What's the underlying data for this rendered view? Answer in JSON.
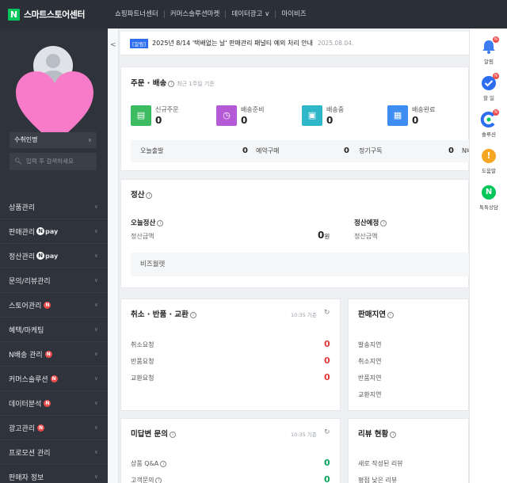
{
  "header": {
    "brand_letter": "N",
    "brand_title": "스마트스토어센터",
    "nav": [
      "쇼핑파트너센터",
      "커머스솔루션마켓",
      "데이터광고 ∨",
      "마이비즈"
    ]
  },
  "sidebar": {
    "store_name": "수취인명",
    "search_placeholder": "입력 후 검색하세요",
    "menu": [
      {
        "label": "상품관리"
      },
      {
        "label": "판매관리",
        "pay": "pay"
      },
      {
        "label": "정산관리",
        "pay": "pay"
      },
      {
        "label": "문의/리뷰관리"
      },
      {
        "label": "스토어관리",
        "badge": "N"
      },
      {
        "label": "혜택/마케팅"
      },
      {
        "label": "N배송 관리",
        "badge": "N"
      },
      {
        "label": "커머스솔루션",
        "badge": "N"
      },
      {
        "label": "데이터분석",
        "badge": "N"
      },
      {
        "label": "광고관리",
        "badge": "N"
      },
      {
        "label": "프로모션 관리"
      },
      {
        "label": "판매자 정보"
      }
    ],
    "npay_letter": "N",
    "colors": {
      "bg": "#2f333b",
      "badge": "#ef4b4b"
    }
  },
  "notice": {
    "tag": "[알림]",
    "text": "2025년 8/14 '택배없는 날' 판매관리 패널티 예외 처리 안내",
    "date": "2025.08.04."
  },
  "order": {
    "title": "주문 · 배송",
    "note": "최근 1주일 기준",
    "stats": [
      {
        "label": "신규주문",
        "value": "0",
        "icon": "new-order-icon",
        "color": "#3dbb61"
      },
      {
        "label": "배송준비",
        "value": "0",
        "icon": "clock-icon",
        "color": "#b55ad6"
      },
      {
        "label": "배송중",
        "value": "0",
        "icon": "truck-icon",
        "color": "#2fb6c9"
      },
      {
        "label": "배송완료",
        "value": "0",
        "icon": "gift-icon",
        "color": "#3d8ef0"
      }
    ],
    "row": [
      {
        "label": "오늘출발",
        "value": "0"
      },
      {
        "label": "예약구매",
        "value": "0"
      },
      {
        "label": "정기구독",
        "value": "0"
      },
      {
        "label": "N배송",
        "value": ""
      }
    ]
  },
  "settlement": {
    "title": "정산",
    "today_label": "오늘정산",
    "today_sub": "정산금액",
    "today_value": "0",
    "unit": "원",
    "expected_label": "정산예정",
    "expected_sub": "정산금액",
    "bizwallet": "비즈월렛"
  },
  "claims": {
    "title": "취소 · 반품 · 교환",
    "time": "10:35 기준",
    "rows": [
      {
        "label": "취소요청",
        "value": "0"
      },
      {
        "label": "반품요청",
        "value": "0"
      },
      {
        "label": "교환요청",
        "value": "0"
      }
    ]
  },
  "delay": {
    "title": "판매지연",
    "rows": [
      "발송지연",
      "취소지연",
      "반품지연",
      "교환지연"
    ]
  },
  "inquiry": {
    "title": "미답변 문의",
    "time": "10:35 기준",
    "rows": [
      {
        "label": "상품 Q&A",
        "value": "0"
      },
      {
        "label": "고객문의",
        "value": "0"
      }
    ]
  },
  "review": {
    "title": "리뷰 현황",
    "rows": [
      "새로 작성된 리뷰",
      "평점 낮은 리뷰"
    ]
  },
  "rail": [
    {
      "label": "알림",
      "icon": "bell-icon",
      "color": "#3d7bf0",
      "dot": "N"
    },
    {
      "label": "할 일",
      "icon": "check-icon",
      "color": "#2d6ef0",
      "dot": "N"
    },
    {
      "label": "솔루션",
      "icon": "solution-icon",
      "color": "#2d6ef0",
      "dot": "N"
    },
    {
      "label": "도움말",
      "icon": "help-icon",
      "color": "#f5a623",
      "glyph": "!"
    },
    {
      "label": "톡톡상담",
      "icon": "talk-icon",
      "color": "#03c75a",
      "glyph": "N"
    }
  ]
}
